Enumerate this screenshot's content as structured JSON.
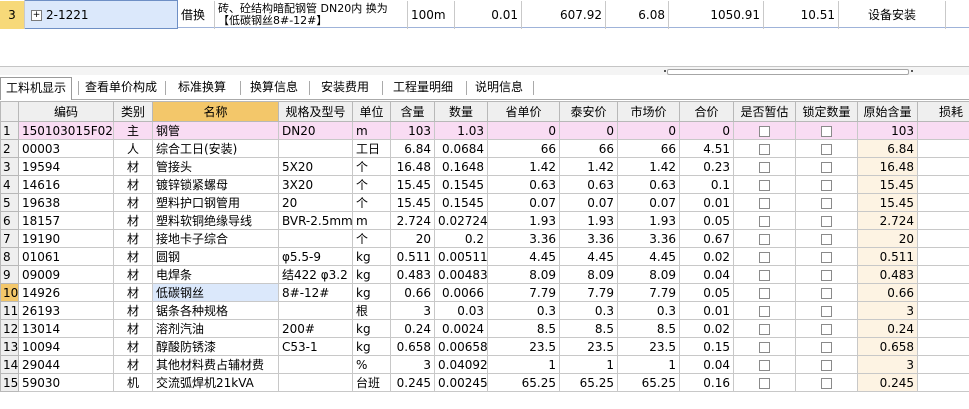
{
  "top_row": {
    "row_num": "3",
    "code": "2-1221",
    "type": "借换",
    "name": "砖、砼结构暗配钢管 DN20内  换为【低碳钢丝8#-12#】",
    "unit": "100m",
    "qty": "0.01",
    "unit_price": "607.92",
    "total_price": "6.08",
    "labor_unit": "1050.91",
    "labor_total": "10.51",
    "specialty": "设备安装"
  },
  "tabs": [
    "工料机显示",
    "查看单价构成",
    "标准换算",
    "换算信息",
    "安装费用",
    "工程量明细",
    "说明信息"
  ],
  "columns": [
    "编码",
    "类别",
    "名称",
    "规格及型号",
    "单位",
    "含量",
    "数量",
    "省单价",
    "泰安价",
    "市场价",
    "合价",
    "是否暂估",
    "锁定数量",
    "原始含量",
    "损耗"
  ],
  "rows": [
    {
      "n": "1",
      "code": "150103015F02",
      "cat": "主",
      "name": "钢管",
      "spec": "DN20",
      "unit": "m",
      "content": "103",
      "qty": "1.03",
      "prov": "0",
      "taian": "0",
      "market": "0",
      "total": "0",
      "orig": "103"
    },
    {
      "n": "2",
      "code": "00003",
      "cat": "人",
      "name": "综合工日(安装)",
      "spec": "",
      "unit": "工日",
      "content": "6.84",
      "qty": "0.0684",
      "prov": "66",
      "taian": "66",
      "market": "66",
      "total": "4.51",
      "orig": "6.84"
    },
    {
      "n": "3",
      "code": "19594",
      "cat": "材",
      "name": "管接头",
      "spec": "5X20",
      "unit": "个",
      "content": "16.48",
      "qty": "0.1648",
      "prov": "1.42",
      "taian": "1.42",
      "market": "1.42",
      "total": "0.23",
      "orig": "16.48"
    },
    {
      "n": "4",
      "code": "14616",
      "cat": "材",
      "name": "镀锌锁紧螺母",
      "spec": "3X20",
      "unit": "个",
      "content": "15.45",
      "qty": "0.1545",
      "prov": "0.63",
      "taian": "0.63",
      "market": "0.63",
      "total": "0.1",
      "orig": "15.45"
    },
    {
      "n": "5",
      "code": "19638",
      "cat": "材",
      "name": "塑料护口钢管用",
      "spec": "20",
      "unit": "个",
      "content": "15.45",
      "qty": "0.1545",
      "prov": "0.07",
      "taian": "0.07",
      "market": "0.07",
      "total": "0.01",
      "orig": "15.45"
    },
    {
      "n": "6",
      "code": "18157",
      "cat": "材",
      "name": "塑料软铜绝缘导线",
      "spec": "BVR-2.5mm2",
      "unit": "m",
      "content": "2.724",
      "qty": "0.02724",
      "prov": "1.93",
      "taian": "1.93",
      "market": "1.93",
      "total": "0.05",
      "orig": "2.724"
    },
    {
      "n": "7",
      "code": "19190",
      "cat": "材",
      "name": "接地卡子综合",
      "spec": "",
      "unit": "个",
      "content": "20",
      "qty": "0.2",
      "prov": "3.36",
      "taian": "3.36",
      "market": "3.36",
      "total": "0.67",
      "orig": "20"
    },
    {
      "n": "8",
      "code": "01061",
      "cat": "材",
      "name": "圆钢",
      "spec": "φ5.5-9",
      "unit": "kg",
      "content": "0.511",
      "qty": "0.00511",
      "prov": "4.45",
      "taian": "4.45",
      "market": "4.45",
      "total": "0.02",
      "orig": "0.511"
    },
    {
      "n": "9",
      "code": "09009",
      "cat": "材",
      "name": "电焊条",
      "spec": "结422 φ3.2",
      "unit": "kg",
      "content": "0.483",
      "qty": "0.00483",
      "prov": "8.09",
      "taian": "8.09",
      "market": "8.09",
      "total": "0.04",
      "orig": "0.483"
    },
    {
      "n": "10",
      "code": "14926",
      "cat": "材",
      "name": "低碳钢丝",
      "spec": "8#-12#",
      "unit": "kg",
      "content": "0.66",
      "qty": "0.0066",
      "prov": "7.79",
      "taian": "7.79",
      "market": "7.79",
      "total": "0.05",
      "orig": "0.66"
    },
    {
      "n": "11",
      "code": "26193",
      "cat": "材",
      "name": "锯条各种规格",
      "spec": "",
      "unit": "根",
      "content": "3",
      "qty": "0.03",
      "prov": "0.3",
      "taian": "0.3",
      "market": "0.3",
      "total": "0.01",
      "orig": "3"
    },
    {
      "n": "12",
      "code": "13014",
      "cat": "材",
      "name": "溶剂汽油",
      "spec": "200#",
      "unit": "kg",
      "content": "0.24",
      "qty": "0.0024",
      "prov": "8.5",
      "taian": "8.5",
      "market": "8.5",
      "total": "0.02",
      "orig": "0.24"
    },
    {
      "n": "13",
      "code": "10094",
      "cat": "材",
      "name": "醇酸防锈漆",
      "spec": "C53-1",
      "unit": "kg",
      "content": "0.658",
      "qty": "0.00658",
      "prov": "23.5",
      "taian": "23.5",
      "market": "23.5",
      "total": "0.15",
      "orig": "0.658"
    },
    {
      "n": "14",
      "code": "29044",
      "cat": "材",
      "name": "其他材料费占辅材费",
      "spec": "",
      "unit": "%",
      "content": "3",
      "qty": "0.04092",
      "prov": "1",
      "taian": "1",
      "market": "1",
      "total": "0.04",
      "orig": "3"
    },
    {
      "n": "15",
      "code": "59030",
      "cat": "机",
      "name": "交流弧焊机21kVA",
      "spec": "",
      "unit": "台班",
      "content": "0.245",
      "qty": "0.00245",
      "prov": "65.25",
      "taian": "65.25",
      "market": "65.25",
      "total": "0.16",
      "orig": "0.245"
    }
  ]
}
